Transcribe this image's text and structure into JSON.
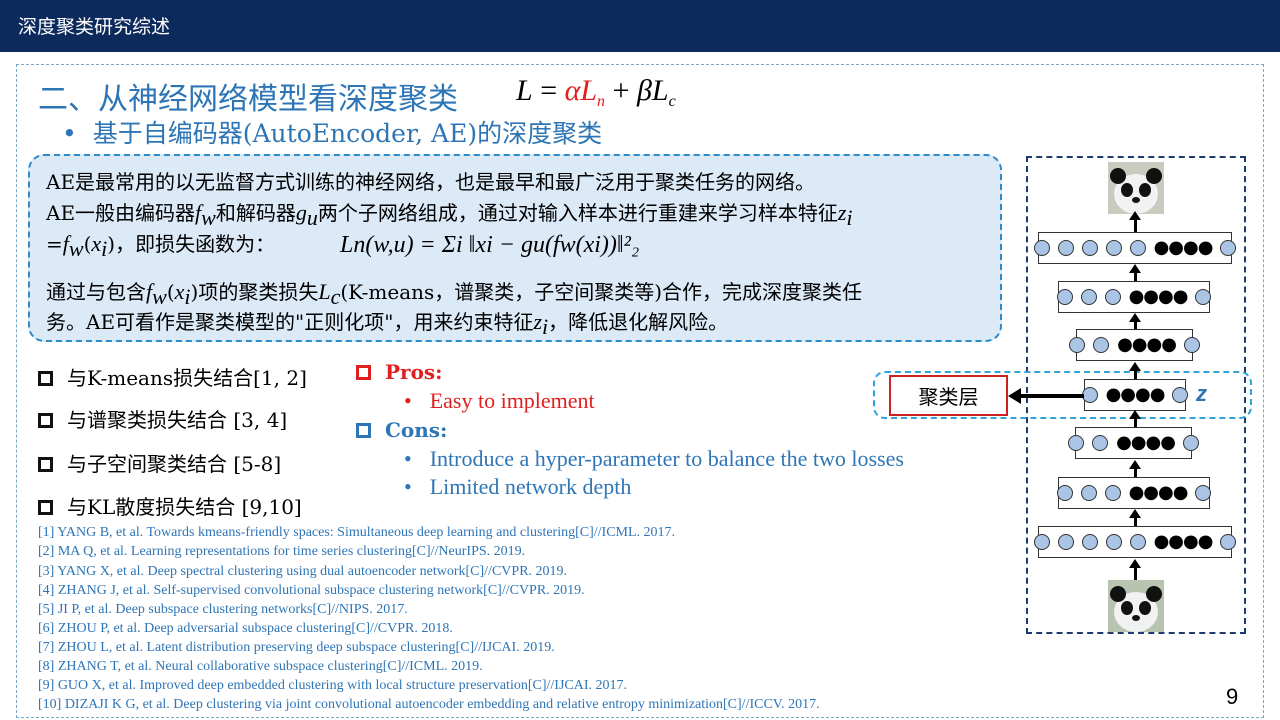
{
  "header": {
    "title": "深度聚类研究综述"
  },
  "slide": {
    "heading": "二、从神经网络模型看深度聚类",
    "formula": {
      "L": "L",
      "eq": " = ",
      "alpha": "α",
      "Ln": "L",
      "n": "n",
      "plus": " + ",
      "beta": "β",
      "Lc": "L",
      "c": "c"
    },
    "subheading_bullet": "•",
    "subheading": "基于自编码器(AutoEncoder, AE)的深度聚类",
    "para1_line1": "AE是最常用的以无监督方式训练的神经网络，也是最早和最广泛用于聚类任务的网络。",
    "para1_line2a": "AE一般由编码器",
    "fw": "f",
    "w": "w",
    "para1_line2b": "和解码器",
    "gu": "g",
    "u": "u",
    "para1_line2c": "两个子网络组成，通过对输入样本进行重建来学习样本特征",
    "zi": "z",
    "i": "i",
    "para1_line3a": "=",
    "para1_line3b": "(",
    "xi": "x",
    "para1_line3c": ")，即损失函数为：",
    "loss_formula": "Ln(w,u) = Σi ‖xi − gu(fw(xi))‖²₂",
    "para2_line1a": "通过与包含",
    "para2_line1b": "项的聚类损失",
    "Lc_L": "L",
    "Lc_c": "c",
    "para2_line1c": "(K-means，谱聚类，子空间聚类等)合作，完成深度聚类任",
    "para2_line2a": "务。AE可看作是聚类模型的\"正则化项\"，用来约束特征",
    "para2_line2b": "，降低退化解风险。"
  },
  "combos": [
    "与K-means损失结合[1, 2]",
    "与谱聚类损失结合 [3, 4]",
    "与子空间聚类结合 [5-8]",
    "与KL散度损失结合 [9,10]"
  ],
  "pros": {
    "label": "Pros:",
    "bullet": "•",
    "items": [
      "Easy to implement"
    ]
  },
  "cons": {
    "label": "Cons:",
    "bullet": "•",
    "items": [
      "Introduce a hyper-parameter to balance the two losses",
      "Limited network depth"
    ]
  },
  "references": [
    "[1] YANG B, et al. Towards kmeans-friendly  spaces: Simultaneous  deep learning  and clustering[C]//ICML.  2017.",
    "[2] MA Q, et al. Learning  representations  for time  series clustering[C]//NeurIPS.  2019.",
    "[3] YANG X, et al. Deep spectral clustering  using  dual autoencoder network[C]//CVPR.  2019.",
    "[4] ZHANG J, et al. Self-supervised  convolutional  subspace clustering  network[C]//CVPR.  2019.",
    "[5] JI P, et al. Deep subspace clustering  networks[C]//NIPS.  2017.",
    "[6] ZHOU P, et al. Deep adversarial  subspace clustering[C]//CVPR.  2018.",
    "[7] ZHOU L, et al. Latent distribution  preserving  deep subspace clustering[C]//IJCAI.  2019.",
    "[8] ZHANG T, et al. Neural collaborative  subspace clustering[C]//ICML.  2019.",
    "[9] GUO X, et al. Improved deep embedded clustering  with local structure  preservation[C]//IJCAI.  2017.",
    "[10] DIZAJI K G, et al. Deep clustering  via joint  convolutional  autoencoder  embedding  and relative  entropy minimization[C]//ICCV.  2017."
  ],
  "diagram": {
    "cluster_layer": "聚类层",
    "z_label": "z",
    "dots": "●●●●"
  },
  "page_number": "9",
  "colors": {
    "header_bg": "#0d2a5c",
    "accent_blue": "#2e75b6",
    "red": "#e02020",
    "box_fill": "#dce9f7"
  }
}
